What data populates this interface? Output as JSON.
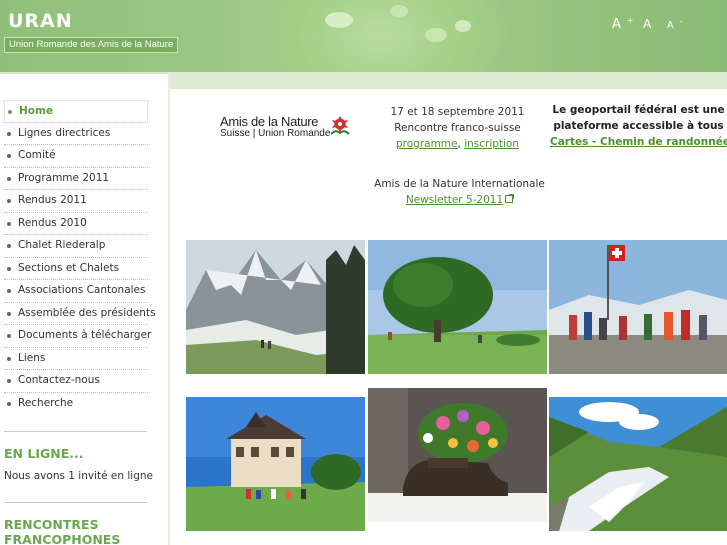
{
  "header": {
    "title": "URAN",
    "subtitle": "Union Romande des Amis de la Nature",
    "font_sizer": {
      "larger": "A",
      "larger_sup": "+",
      "normal": "A",
      "smaller": "A",
      "smaller_sup": "-"
    }
  },
  "nav": {
    "items": [
      {
        "label": "Home",
        "active": true
      },
      {
        "label": "Lignes directrices"
      },
      {
        "label": "Comité"
      },
      {
        "label": "Programme 2011"
      },
      {
        "label": "Rendus 2011"
      },
      {
        "label": "Rendus 2010"
      },
      {
        "label": "Chalet Riederalp"
      },
      {
        "label": "Sections et Chalets"
      },
      {
        "label": "Associations Cantonales"
      },
      {
        "label": "Assemblée des présidents"
      },
      {
        "label": "Documents à télécharger"
      },
      {
        "label": "Liens"
      },
      {
        "label": "Contactez-nous"
      },
      {
        "label": "Recherche"
      }
    ]
  },
  "online": {
    "heading": "EN LIGNE...",
    "text": "Nous avons 1 invité en ligne"
  },
  "rencontres": {
    "heading_line1": "RENCONTRES",
    "heading_line2": "FRANCOPHONES"
  },
  "logo": {
    "line1": "Amis de la Nature",
    "line2": "Suisse | Union Romande"
  },
  "event": {
    "date": "17 et 18 septembre 2011",
    "title": "Rencontre franco-suisse",
    "link1": "programme",
    "separator": ",",
    "link2": "inscription"
  },
  "international": {
    "title": "Amis de la Nature Internationale",
    "link": "Newsletter 5-2011"
  },
  "geoportail": {
    "text_line1": "Le geoportail fédéral est une",
    "text_line2": "plateforme accessible à tous",
    "link": "Cartes - Chemin de randonnées"
  },
  "photos": [
    {
      "name": "mountain-snow-photo"
    },
    {
      "name": "tree-meadow-photo"
    },
    {
      "name": "swiss-flag-group-photo"
    },
    {
      "name": "chalet-hikers-photo"
    },
    {
      "name": "flower-shoe-photo"
    },
    {
      "name": "mountain-stream-photo"
    }
  ],
  "colors": {
    "accent": "#6aa84f",
    "link": "#4e8f33",
    "header_green": "#9cc885"
  }
}
